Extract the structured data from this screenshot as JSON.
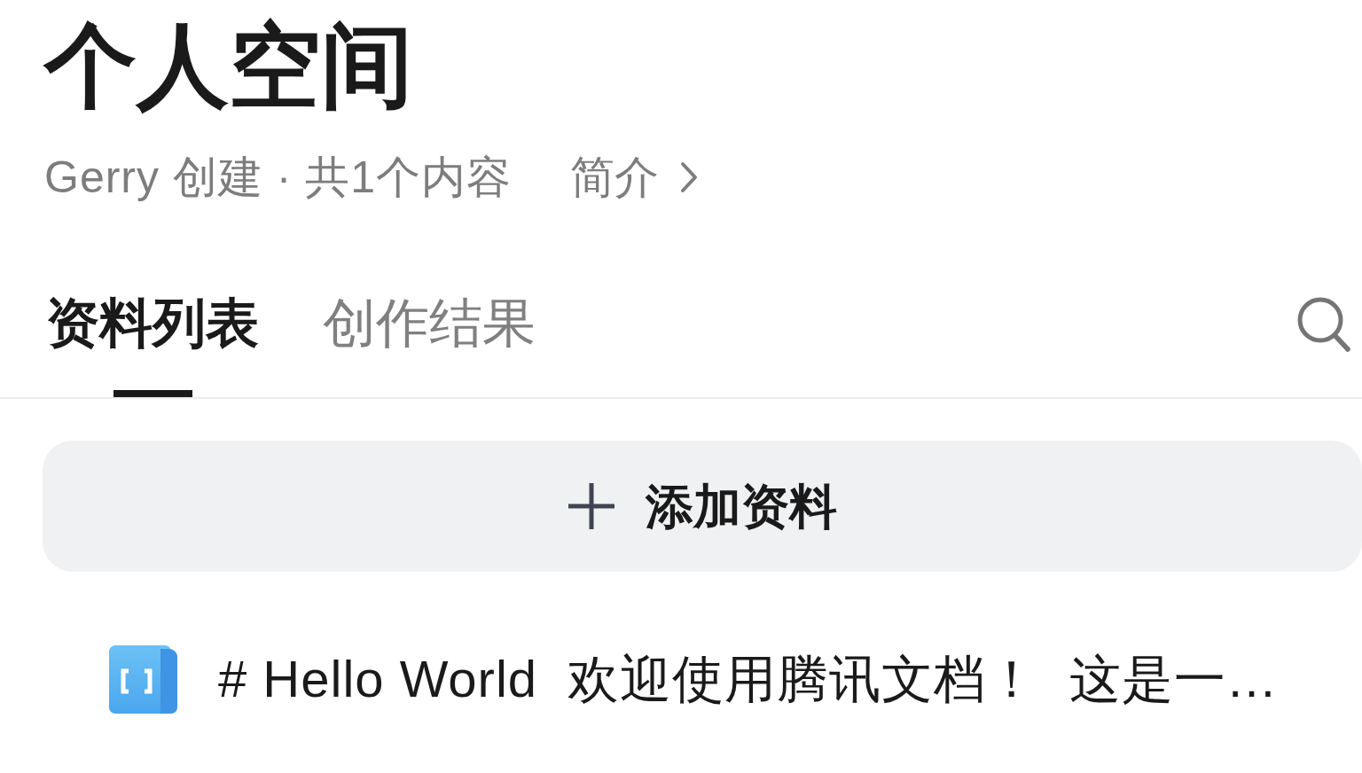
{
  "header": {
    "title": "个人空间",
    "meta": "Gerry 创建 · 共1个内容",
    "intro_link": "简介"
  },
  "tabs": [
    {
      "label": "资料列表",
      "selected": true
    },
    {
      "label": "创作结果",
      "selected": false
    }
  ],
  "add_button": {
    "label": "添加资料"
  },
  "items": [
    {
      "text": "# Hello World  欢迎使用腾讯文档！  这是一…"
    }
  ]
}
